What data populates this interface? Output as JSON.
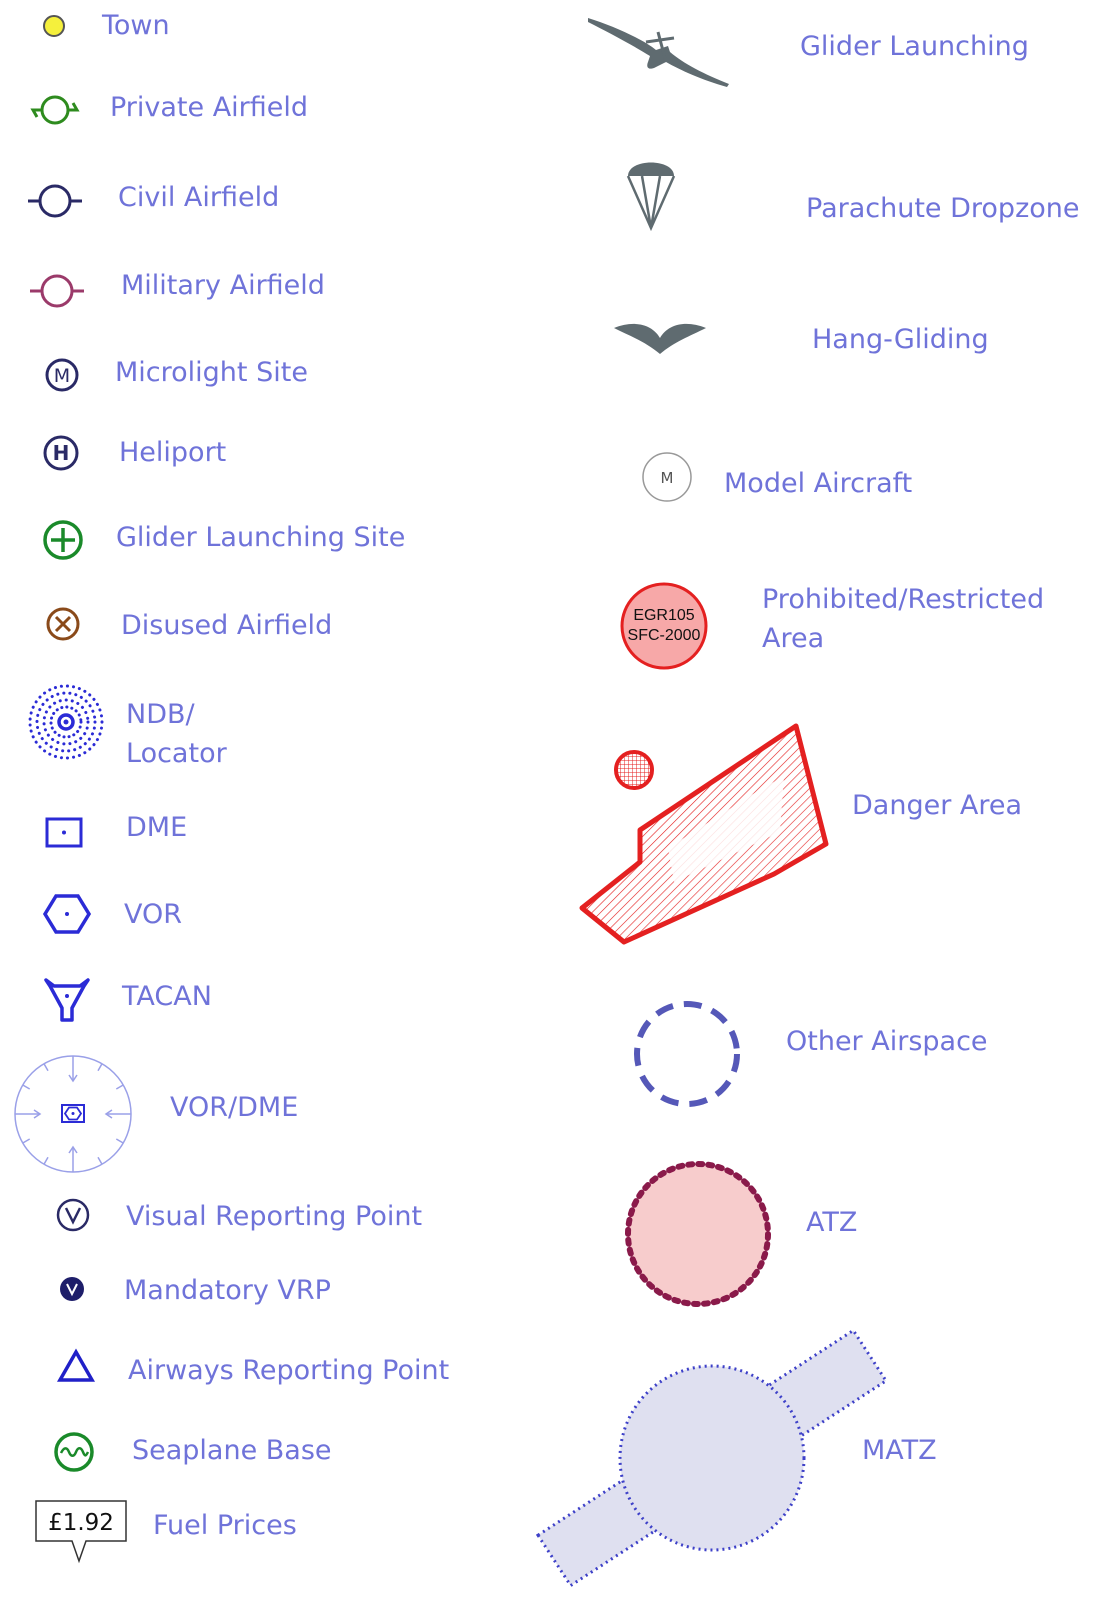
{
  "legend": {
    "left": {
      "town": "Town",
      "private_airfield": "Private Airfield",
      "civil_airfield": "Civil Airfield",
      "military_airfield": "Military Airfield",
      "microlight_site": "Microlight Site",
      "heliport": "Heliport",
      "glider_launching_site": "Glider Launching Site",
      "disused_airfield": "Disused Airfield",
      "ndb_line1": "NDB/",
      "ndb_line2": "Locator",
      "dme": "DME",
      "vor": "VOR",
      "tacan": "TACAN",
      "vor_dme": "VOR/DME",
      "visual_reporting_point": "Visual Reporting Point",
      "mandatory_vrp": "Mandatory VRP",
      "airways_reporting_point": "Airways Reporting Point",
      "seaplane_base": "Seaplane Base",
      "fuel_prices": "Fuel Prices"
    },
    "right": {
      "glider_launching": "Glider Launching",
      "parachute_dropzone": "Parachute Dropzone",
      "hang_gliding": "Hang-Gliding",
      "model_aircraft": "Model Aircraft",
      "prohibited_line1": "Prohibited/Restricted",
      "prohibited_line2": "Area",
      "danger_area": "Danger Area",
      "other_airspace": "Other Airspace",
      "atz": "ATZ",
      "matz": "MATZ"
    },
    "symbol_text": {
      "microlight_letter": "M",
      "heliport_letter": "H",
      "model_letter": "M",
      "prohibited_code": "EGR105",
      "prohibited_limits": "SFC-2000",
      "fuel_price": "£1.92"
    },
    "colors": {
      "label": "#6f73d9",
      "town": "#f5f03c",
      "private": "#2e8b1e",
      "civil": "#2a2a66",
      "military": "#9b3a6a",
      "navaid": "#2b2bd6",
      "glider_site": "#1a8a2a",
      "disused": "#8a4a1a",
      "silhouette": "#5f6b70",
      "restricted_fill": "#f7a8a8",
      "restricted_stroke": "#e42020",
      "atz_fill": "#f7cccc",
      "atz_stroke": "#8a1a4a",
      "other_airspace": "#5558b8",
      "matz_fill": "#dfe0f0",
      "matz_stroke": "#3d40c8"
    }
  }
}
